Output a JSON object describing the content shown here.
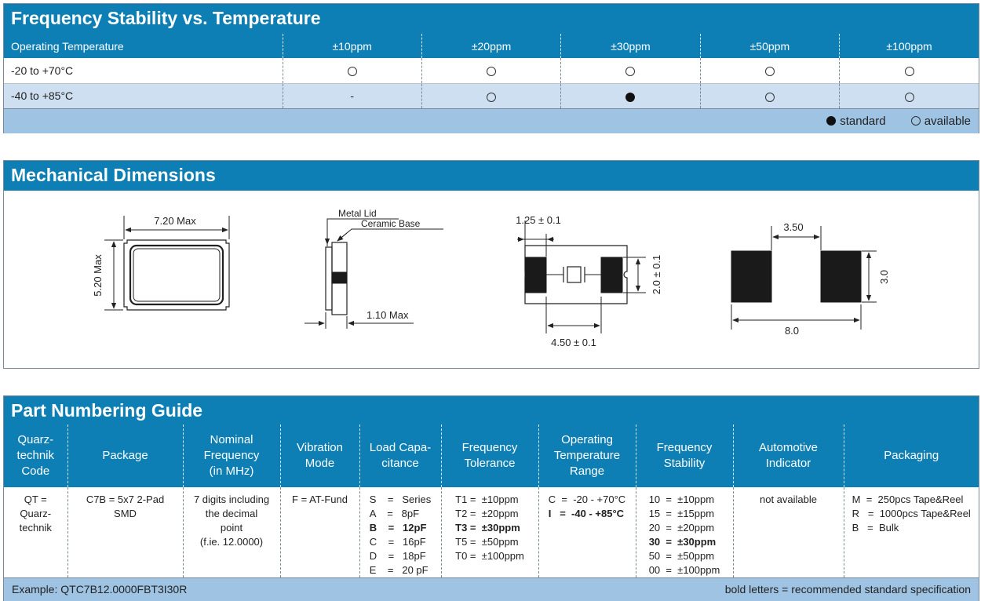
{
  "stability": {
    "title": "Frequency Stability vs. Temperature",
    "header": [
      "Operating Temperature",
      "±10ppm",
      "±20ppm",
      "±30ppm",
      "±50ppm",
      "±100ppm"
    ],
    "rows": [
      {
        "label": "-20 to +70°C",
        "cells": [
          "available",
          "available",
          "available",
          "available",
          "available"
        ]
      },
      {
        "label": "-40 to +85°C",
        "cells": [
          "-",
          "available",
          "standard",
          "available",
          "available"
        ]
      }
    ],
    "legend": {
      "standard": "standard",
      "available": "available"
    }
  },
  "mechanical": {
    "title": "Mechanical Dimensions",
    "labels": {
      "width": "7.20 Max",
      "height": "5.20 Max",
      "metal_lid": "Metal Lid",
      "ceramic_base": "Ceramic Base",
      "thickness": "1.10 Max",
      "pad_width": "1.25 ± 0.1",
      "pad_height": "2.0 ± 0.1",
      "pad_spacing": "4.50 ± 0.1",
      "land_gap": "3.50",
      "land_height": "3.0",
      "land_span": "8.0"
    }
  },
  "part_numbering": {
    "title": "Part Numbering Guide",
    "columns": [
      {
        "header": "Quarz-\ntechnik\nCode",
        "lines": [
          {
            "t": "QT =",
            "b": false
          },
          {
            "t": "Quarz-",
            "b": false
          },
          {
            "t": "technik",
            "b": false
          }
        ]
      },
      {
        "header": "Package",
        "lines": [
          {
            "t": "C7B = 5x7 2-Pad",
            "b": false
          },
          {
            "t": "SMD",
            "b": false
          }
        ]
      },
      {
        "header": "Nominal\nFrequency\n(in MHz)",
        "lines": [
          {
            "t": "7 digits including",
            "b": false
          },
          {
            "t": "the decimal",
            "b": false
          },
          {
            "t": "point",
            "b": false
          },
          {
            "t": "(f.ie. 12.0000)",
            "b": false
          }
        ]
      },
      {
        "header": "Vibration\nMode",
        "lines": [
          {
            "t": "F  =   AT-Fund",
            "b": false
          }
        ]
      },
      {
        "header": "Load Capa-\ncitance",
        "opts": true,
        "lines": [
          {
            "t": "S    =   Series",
            "b": false
          },
          {
            "t": "A    =   8pF",
            "b": false
          },
          {
            "t": "B    =   12pF",
            "b": true
          },
          {
            "t": "C    =   16pF",
            "b": false
          },
          {
            "t": "D    =   18pF",
            "b": false
          },
          {
            "t": "E    =   20 pF",
            "b": false
          }
        ]
      },
      {
        "header": "Frequency\nTolerance",
        "opts": true,
        "lines": [
          {
            "t": "T1 =  ±10ppm",
            "b": false
          },
          {
            "t": "T2 =  ±20ppm",
            "b": false
          },
          {
            "t": "T3 =  ±30ppm",
            "b": true
          },
          {
            "t": "T5 =  ±50ppm",
            "b": false
          },
          {
            "t": "T0 =  ±100ppm",
            "b": false
          }
        ]
      },
      {
        "header": "Operating\nTemperature\nRange",
        "opts": true,
        "lines": [
          {
            "t": "C  =  -20 - +70°C",
            "b": false
          },
          {
            "t": "I   =  -40 - +85°C",
            "b": true
          }
        ]
      },
      {
        "header": "Frequency\nStability",
        "opts": true,
        "lines": [
          {
            "t": "10  =  ±10ppm",
            "b": false
          },
          {
            "t": "15  =  ±15ppm",
            "b": false
          },
          {
            "t": "20  =  ±20ppm",
            "b": false
          },
          {
            "t": "30  =  ±30ppm",
            "b": true
          },
          {
            "t": "50  =  ±50ppm",
            "b": false
          },
          {
            "t": "00  =  ±100ppm",
            "b": false
          }
        ]
      },
      {
        "header": "Automotive\nIndicator",
        "lines": [
          {
            "t": "not available",
            "b": false
          }
        ]
      },
      {
        "header": "Packaging",
        "opts": true,
        "lines": [
          {
            "t": "M  =  250pcs Tape&Reel",
            "b": false
          },
          {
            "t": "R   =  1000pcs Tape&Reel",
            "b": false
          },
          {
            "t": "B   =  Bulk",
            "b": false
          }
        ]
      }
    ],
    "example": "Example: QTC7B12.0000FBT3I30R",
    "note": "bold letters = recommended standard specification"
  }
}
